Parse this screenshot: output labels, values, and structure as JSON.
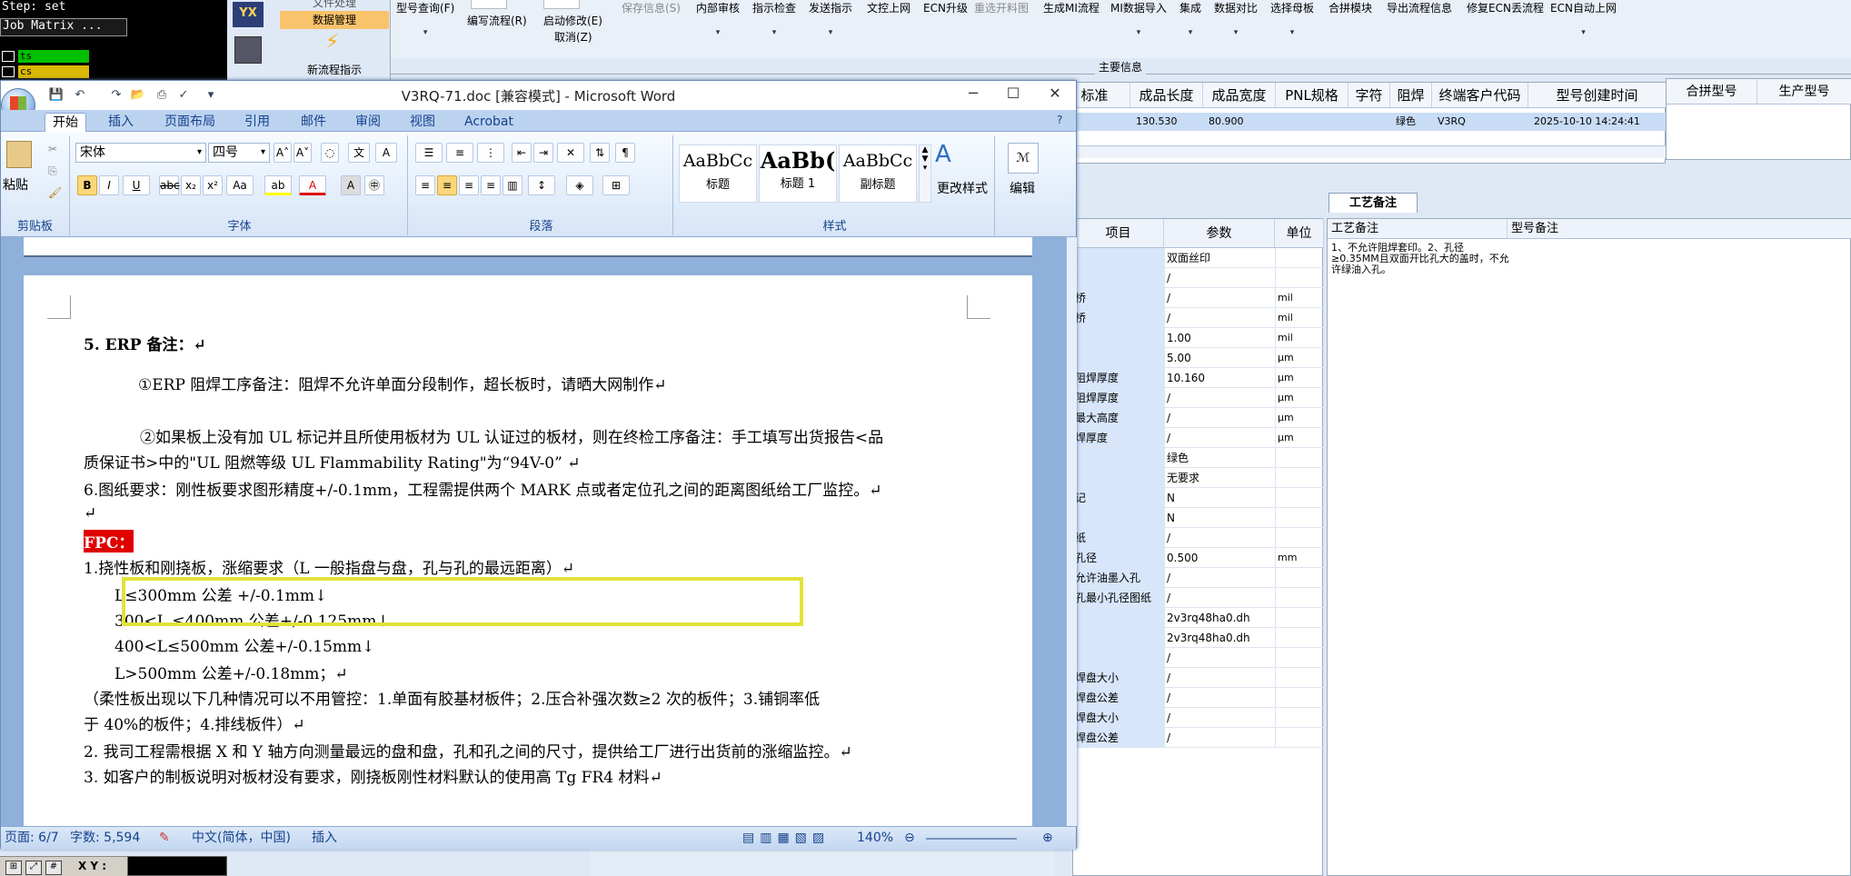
{
  "cam": {
    "step": "Step: set",
    "job": "Job Matrix ...",
    "rows": [
      "ts",
      "cs"
    ],
    "xy_label": "X Y :"
  },
  "vx": {
    "brand": "YX",
    "item1": "文件处理",
    "item2": "数据管理",
    "item3": "新流程指示"
  },
  "toolbar": {
    "items": [
      {
        "label": "型号查询(F)",
        "dim": false
      },
      {
        "label": "编写流程(R)",
        "dim": false
      },
      {
        "label": "启动修改(E)",
        "dim": false
      },
      {
        "label": "取消(Z)",
        "dim": false
      },
      {
        "label": "保存信息(S)",
        "dim": true
      },
      {
        "label": "内部审核",
        "dim": false
      },
      {
        "label": "指示检查",
        "dim": false
      },
      {
        "label": "发送指示",
        "dim": false
      },
      {
        "label": "文控上网",
        "dim": false
      },
      {
        "label": "ECN升级",
        "dim": false
      },
      {
        "label": "重选开料图",
        "dim": true
      },
      {
        "label": "生成MI流程",
        "dim": false
      },
      {
        "label": "MI数据导入",
        "dim": false
      },
      {
        "label": "集成",
        "dim": false
      },
      {
        "label": "数据对比",
        "dim": false
      },
      {
        "label": "选择母板",
        "dim": false
      },
      {
        "label": "合拼模块",
        "dim": false
      },
      {
        "label": "导出流程信息",
        "dim": false
      },
      {
        "label": "修复ECN丢流程",
        "dim": false
      },
      {
        "label": "ECN自动上网",
        "dim": false
      }
    ]
  },
  "info_title": "主要信息",
  "grid": {
    "headers": [
      "标准",
      "成品长度",
      "成品宽度",
      "PNL规格",
      "字符",
      "阻焊",
      "终端客户代码",
      "型号创建时间"
    ],
    "row": [
      "级",
      "130.530",
      "80.900",
      "",
      "",
      "绿色",
      "V3RQ",
      "2025-10-10 14:24:41"
    ],
    "headers2": [
      "合拼型号",
      "生产型号"
    ]
  },
  "tab_label": "工艺备注",
  "params": {
    "headers": [
      "项目",
      "参数",
      "单位"
    ],
    "rows": [
      {
        "n": "",
        "v": "双面丝印",
        "u": ""
      },
      {
        "n": "",
        "v": "/",
        "u": ""
      },
      {
        "n": "桥",
        "v": "/",
        "u": "mil"
      },
      {
        "n": "桥",
        "v": "/",
        "u": "mil"
      },
      {
        "n": "",
        "v": "1.00",
        "u": "mil"
      },
      {
        "n": "",
        "v": "5.00",
        "u": "μm"
      },
      {
        "n": "阻焊厚度",
        "v": "10.160",
        "u": "μm"
      },
      {
        "n": "阻焊厚度",
        "v": "/",
        "u": "μm"
      },
      {
        "n": "最大高度",
        "v": "/",
        "u": "μm"
      },
      {
        "n": "焊厚度",
        "v": "/",
        "u": "μm"
      },
      {
        "n": "",
        "v": "绿色",
        "u": ""
      },
      {
        "n": "",
        "v": "无要求",
        "u": ""
      },
      {
        "n": "记",
        "v": "N",
        "u": ""
      },
      {
        "n": "",
        "v": "N",
        "u": ""
      },
      {
        "n": "纸",
        "v": "/",
        "u": ""
      },
      {
        "n": "孔径",
        "v": "0.500",
        "u": "mm"
      },
      {
        "n": "允许油墨入孔",
        "v": "/",
        "u": ""
      },
      {
        "n": "孔最小孔径图纸",
        "v": "/",
        "u": ""
      },
      {
        "n": "",
        "v": "2v3rq48ha0.dh",
        "u": ""
      },
      {
        "n": "",
        "v": "2v3rq48ha0.dh",
        "u": ""
      },
      {
        "n": "",
        "v": "/",
        "u": ""
      },
      {
        "n": "焊盘大小",
        "v": "/",
        "u": ""
      },
      {
        "n": "焊盘公差",
        "v": "/",
        "u": ""
      },
      {
        "n": "焊盘大小",
        "v": "/",
        "u": ""
      },
      {
        "n": "焊盘公差",
        "v": "/",
        "u": ""
      }
    ]
  },
  "notes": {
    "h1": "工艺备注",
    "h2": "型号备注",
    "text": "1、不允许阻焊套印。2、孔径≥0.35MM且双面开比孔大的盖时，不允许绿油入孔。"
  },
  "word": {
    "title": "V3RQ-71.doc [兼容模式] - Microsoft Word",
    "tabs": [
      "开始",
      "插入",
      "页面布局",
      "引用",
      "邮件",
      "审阅",
      "视图",
      "Acrobat"
    ],
    "clipboard": {
      "paste": "粘贴",
      "group": "剪贴板"
    },
    "font": {
      "name": "宋体",
      "size": "四号",
      "group": "字体"
    },
    "paragraph_group": "段落",
    "styles": [
      {
        "preview": "AaBbCc",
        "label": "标题"
      },
      {
        "preview": "AaBb(",
        "label": "标题 1"
      },
      {
        "preview": "AaBbCc",
        "label": "副标题"
      }
    ],
    "styles_group": "样式",
    "change_styles": "更改样式",
    "edit": "编辑",
    "doc_lines": [
      "5. ERP 备注：↵",
      "①ERP 阻焊工序备注：阻焊不允许单面分段制作，超长板时，请晒大网制作↵",
      "②如果板上没有加 UL 标记并且所使用板材为 UL 认证过的板材，则在终检工序备注：手工填写出货报告<品",
      "质保证书>中的\"UL 阻燃等级 UL Flammability Rating\"为“94V-0”        ↵",
      "6.图纸要求：刚性板要求图形精度+/-0.1mm，工程需提供两个 MARK 点或者定位孔之间的距离图纸给工厂监控。↵",
      "↵",
      "FPC：",
      "1.挠性板和刚挠板，涨缩要求（L 一般指盘与盘，孔与孔的最远距离）↵",
      "L≤300mm 公差 +/-0.1mm↓",
      "300<L ≤400mm 公差+/-0.125mm↓",
      "400<L≤500mm 公差+/-0.15mm↓",
      "L>500mm 公差+/-0.18mm；↵",
      "（柔性板出现以下几种情况可以不用管控：1.单面有胶基材板件；2.压合补强次数≥2 次的板件；3.铺铜率低",
      "于 40%的板件；4.排线板件）↵",
      "2.   我司工程需根据 X 和 Y 轴方向测量最远的盘和盘，孔和孔之间的尺寸，提供给工厂进行出货前的涨缩监控。↵",
      "3. 如客户的制板说明对板材没有要求，刚挠板刚性材料默认的使用高 Tg FR4 材料↵"
    ],
    "status": {
      "page": "页面: 6/7",
      "words": "字数: 5,594",
      "lang": "中文(简体，中国)",
      "mode": "插入",
      "zoom": "140%"
    }
  }
}
